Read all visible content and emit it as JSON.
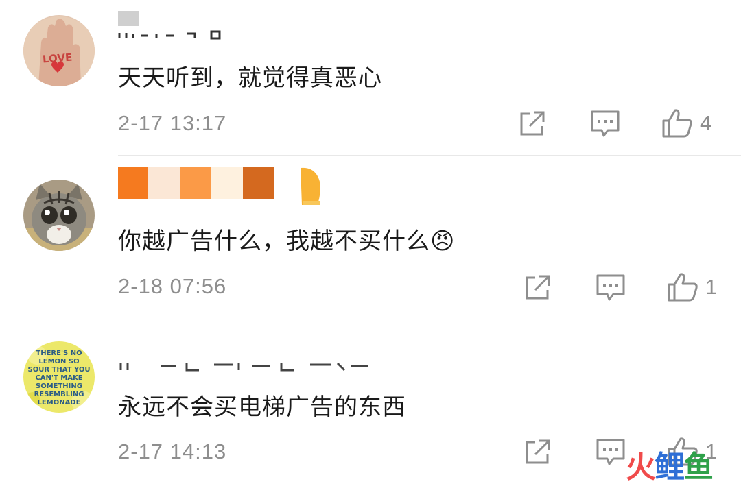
{
  "comments": [
    {
      "text": "天天听到，就觉得真恶心",
      "time": "2-17 13:17",
      "likes": "4",
      "avatar": "love-hand-avatar",
      "username_visibility": "obscured"
    },
    {
      "text": "你越广告什么，我越不买什么😠",
      "time": "2-18 07:56",
      "likes": "1",
      "avatar": "cat-avatar",
      "username_visibility": "obscured"
    },
    {
      "text": "永远不会买电梯广告的东西",
      "time": "2-17 14:13",
      "likes": "1",
      "avatar": "lemon-avatar",
      "username_visibility": "obscured"
    }
  ],
  "avatar_text": {
    "love": "LOVE",
    "lemon": "THERE'S NO LEMON SO SOUR THAT YOU CAN'T MAKE SOMETHING RESEMBLING LEMONADE"
  },
  "watermark": {
    "part1": "火",
    "part2": "鲤",
    "part3": "鱼"
  },
  "colors": {
    "text": "#1a1a1a",
    "meta": "#8e8e8e",
    "divider": "#e8e8e8",
    "mosaic": [
      "#f57a1f",
      "#fbe7d6",
      "#fb9a47",
      "#fef1df",
      "#d4691f",
      "#f8b234"
    ]
  }
}
